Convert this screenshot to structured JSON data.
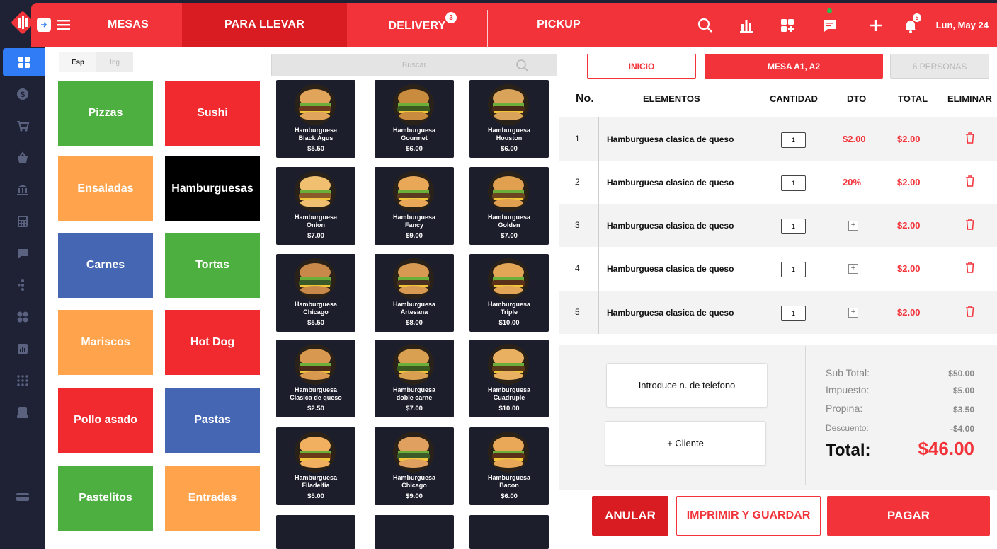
{
  "topbar": {
    "tabs": [
      "MESAS",
      "PARA LLEVAR",
      "DELIVERY",
      "PICKUP"
    ],
    "delivery_badge": "3",
    "notifications_badge": "5",
    "date": "Lun, May 24"
  },
  "language": {
    "active": "Esp",
    "inactive": "Ing"
  },
  "categories": [
    {
      "label": "Pizzas",
      "color": "#4caf3f"
    },
    {
      "label": "Sushi",
      "color": "#f12a2f"
    },
    {
      "label": "Ensaladas",
      "color": "#ffa44c"
    },
    {
      "label": "Hamburguesas",
      "color": "#000000"
    },
    {
      "label": "Carnes",
      "color": "#4566b3"
    },
    {
      "label": "Tortas",
      "color": "#4caf3f"
    },
    {
      "label": "Mariscos",
      "color": "#ffa44c"
    },
    {
      "label": "Hot Dog",
      "color": "#f12a2f"
    },
    {
      "label": "Pollo asado",
      "color": "#f12a2f"
    },
    {
      "label": "Pastas",
      "color": "#4566b3"
    },
    {
      "label": "Pastelitos",
      "color": "#4caf3f"
    },
    {
      "label": "Entradas",
      "color": "#ffa44c"
    }
  ],
  "search": {
    "placeholder": "Buscar"
  },
  "products": [
    {
      "name1": "Hamburguesa",
      "name2": "Black Agus",
      "price": "$5.50"
    },
    {
      "name1": "Hamburguesa",
      "name2": "Gourmet",
      "price": "$6.00"
    },
    {
      "name1": "Hamburguesa",
      "name2": "Houston",
      "price": "$6.00"
    },
    {
      "name1": "Hamburguesa",
      "name2": "Onion",
      "price": "$7.00"
    },
    {
      "name1": "Hamburguesa",
      "name2": "Fancy",
      "price": "$9.00"
    },
    {
      "name1": "Hamburguesa",
      "name2": "Golden",
      "price": "$7.00"
    },
    {
      "name1": "Hamburguesa",
      "name2": "Chicago",
      "price": "$5.50"
    },
    {
      "name1": "Hamburguesa",
      "name2": "Artesana",
      "price": "$8.00"
    },
    {
      "name1": "Hamburguesa",
      "name2": "Triple",
      "price": "$10.00"
    },
    {
      "name1": "Hamburguesa",
      "name2": "Clasica de queso",
      "price": "$2.50"
    },
    {
      "name1": "Hamburguesa",
      "name2": "doble carne",
      "price": "$7.00"
    },
    {
      "name1": "Hamburguesa",
      "name2": "Cuadruple",
      "price": "$10.00"
    },
    {
      "name1": "Hamburguesa",
      "name2": "Filadelfia",
      "price": "$5.00"
    },
    {
      "name1": "Hamburguesa",
      "name2": "Chicago",
      "price": "$9.00"
    },
    {
      "name1": "Hamburguesa",
      "name2": "Bacon",
      "price": "$6.00"
    }
  ],
  "order": {
    "buttons": {
      "inicio": "INICIO",
      "mesa": "MESA A1, A2",
      "personas": "6 PERSONAS"
    },
    "headers": {
      "no": "No.",
      "elementos": "ELEMENTOS",
      "cantidad": "CANTIDAD",
      "dto": "DTO",
      "total": "TOTAL",
      "eliminar": "ELIMINAR"
    },
    "rows": [
      {
        "no": "1",
        "item": "Hamburguesa clasica de queso",
        "qty": "1",
        "dto": "$2.00",
        "total": "$2.00"
      },
      {
        "no": "2",
        "item": "Hamburguesa clasica de queso",
        "qty": "1",
        "dto": "20%",
        "total": "$2.00"
      },
      {
        "no": "3",
        "item": "Hamburguesa clasica de queso",
        "qty": "1",
        "dto": "",
        "total": "$2.00"
      },
      {
        "no": "4",
        "item": "Hamburguesa clasica de queso",
        "qty": "1",
        "dto": "",
        "total": "$2.00"
      },
      {
        "no": "5",
        "item": "Hamburguesa clasica de queso",
        "qty": "1",
        "dto": "",
        "total": "$2.00"
      }
    ],
    "phone_placeholder": "Introduce n. de telefono",
    "add_client": "+ Cliente",
    "summary": {
      "subtotal_label": "Sub Total:",
      "subtotal": "$50.00",
      "tax_label": "Impuesto:",
      "tax": "$5.00",
      "tip_label": "Propina:",
      "tip": "$3.50",
      "discount_label": "Descuento:",
      "discount": "-$4.00",
      "total_label": "Total:",
      "total": "$46.00"
    },
    "actions": {
      "anular": "ANULAR",
      "imprimir": "IMPRIMIR Y GUARDAR",
      "pagar": "PAGAR"
    }
  },
  "colors": {
    "brand_red": "#f2333a",
    "active_tab": "#d81c22",
    "rail_bg": "#1f2235",
    "rail_active": "#2f7cf6"
  }
}
